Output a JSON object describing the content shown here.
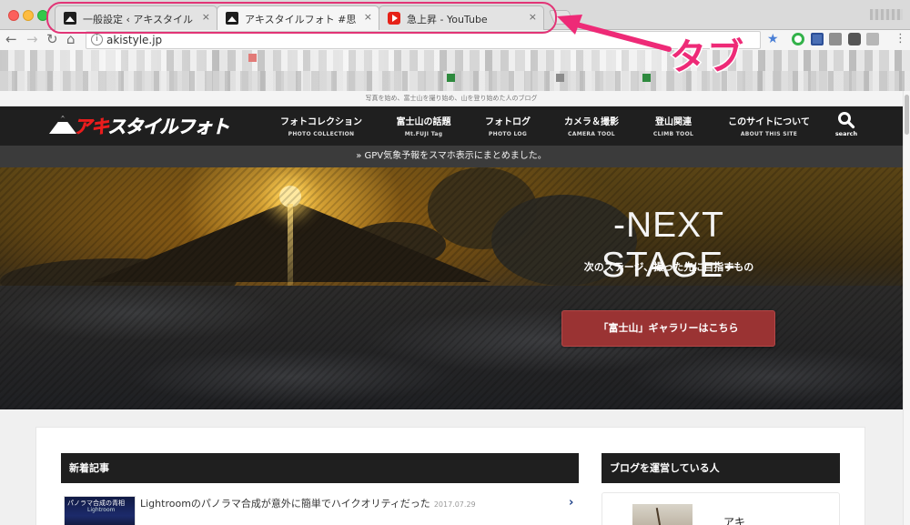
{
  "browser": {
    "tabs": [
      {
        "title": "一般設定 ‹ アキスタイルフォト —",
        "active": false,
        "favicon": "site-icon"
      },
      {
        "title": "アキスタイルフォト #思うままに撮",
        "active": true,
        "favicon": "site-icon"
      },
      {
        "title": "急上昇 - YouTube",
        "active": false,
        "favicon": "youtube-icon"
      }
    ],
    "close_glyph": "×",
    "url": "akistyle.jp",
    "info_glyph": "i",
    "annotation_label": "タブ",
    "annotation_color": "#ee2a77"
  },
  "site": {
    "tagline": "写真を始め、富士山を撮り始め、山を登り始めた人のブログ",
    "logo_text_red": "アキ",
    "logo_text_white": "スタイルフォト",
    "nav": [
      {
        "jp": "フォトコレクション",
        "en": "PHOTO COLLECTION"
      },
      {
        "jp": "富士山の話題",
        "en": "Mt.FUJI Tag"
      },
      {
        "jp": "フォトログ",
        "en": "PHOTO LOG"
      },
      {
        "jp": "カメラ＆撮影",
        "en": "CAMERA TOOL"
      },
      {
        "jp": "登山関連",
        "en": "CLIMB TOOL"
      },
      {
        "jp": "このサイトについて",
        "en": "ABOUT THIS SITE"
      }
    ],
    "search_label": "search",
    "notice": "» GPV気象予報をスマホ表示にまとめました。",
    "hero": {
      "heading": "-NEXT STAGE-",
      "subheading": "次のステージ、撮った先に目指すもの",
      "cta": "「富士山」ギャラリーはこちら",
      "cta_color": "#9a3333"
    },
    "latest": {
      "heading": "新着記事",
      "posts": [
        {
          "thumb_text": "パノラマ合成の青相",
          "thumb_sub": "Lightroom",
          "title": "Lightroomのパノラマ合成が意外に簡単でハイクオリティだった",
          "date": "2017.07.29",
          "chevron": "›"
        }
      ]
    },
    "sidebar": {
      "heading": "ブログを運営している人",
      "name": "アキ"
    }
  }
}
